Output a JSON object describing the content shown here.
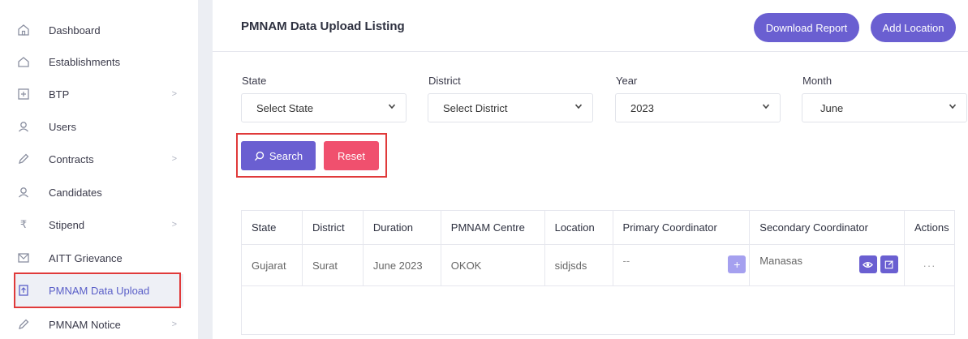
{
  "sidebar": {
    "items": [
      {
        "label": "Dashboard",
        "icon": "home-icon"
      },
      {
        "label": "Establishments",
        "icon": "house-outline-icon"
      },
      {
        "label": "BTP",
        "icon": "square-plus-icon",
        "chevron": ">"
      },
      {
        "label": "Users",
        "icon": "users-icon"
      },
      {
        "label": "Contracts",
        "icon": "pen-icon",
        "chevron": ">"
      },
      {
        "label": "Candidates",
        "icon": "candidates-icon"
      },
      {
        "label": "Stipend",
        "icon": "rupee-icon",
        "chevron": ">"
      },
      {
        "label": "AITT Grievance",
        "icon": "grievance-icon"
      },
      {
        "label": "PMNAM Data Upload",
        "icon": "upload-doc-icon",
        "active": true
      },
      {
        "label": "PMNAM Notice",
        "icon": "pen-icon",
        "chevron": ">"
      }
    ]
  },
  "header": {
    "title": "PMNAM Data Upload Listing",
    "download_label": "Download Report",
    "add_location_label": "Add Location"
  },
  "filters": {
    "state": {
      "label": "State",
      "value": "Select State"
    },
    "district": {
      "label": "District",
      "value": "Select District"
    },
    "year": {
      "label": "Year",
      "value": "2023"
    },
    "month": {
      "label": "Month",
      "value": "June"
    }
  },
  "actions": {
    "search_label": "Search",
    "reset_label": "Reset"
  },
  "table": {
    "headers": [
      "State",
      "District",
      "Duration",
      "PMNAM Centre",
      "Location",
      "Primary Coordinator",
      "Secondary Coordinator",
      "Actions"
    ],
    "rows": [
      {
        "state": "Gujarat",
        "district": "Surat",
        "duration": "June 2023",
        "centre": "OKOK",
        "location": "sidjsds",
        "primary": "--",
        "secondary": "Manasas",
        "actions": "···"
      }
    ]
  },
  "colors": {
    "accent": "#6a5fd1",
    "reset": "#f0506e",
    "highlight": "#e03a3a"
  }
}
